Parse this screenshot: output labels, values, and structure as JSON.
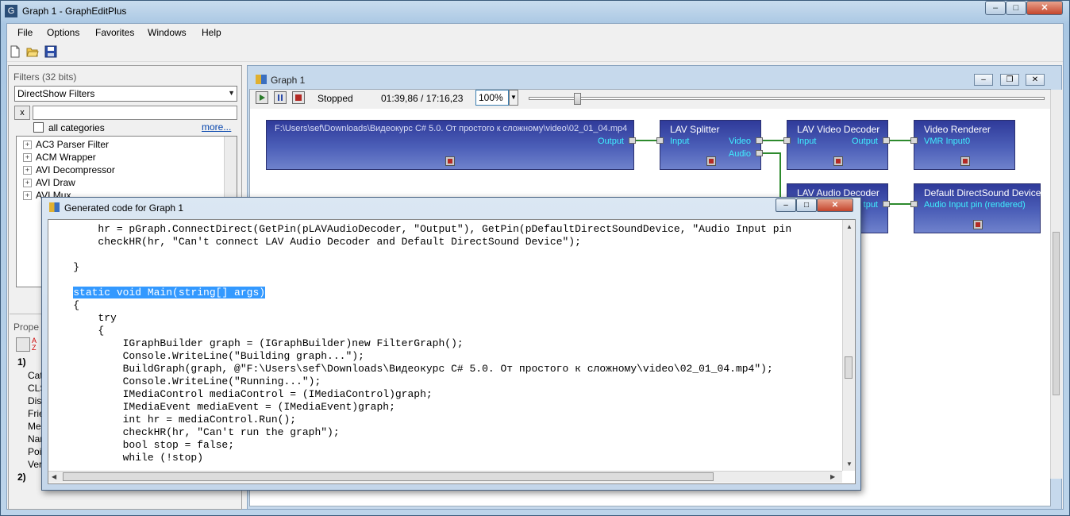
{
  "window": {
    "title": "Graph 1 - GraphEditPlus"
  },
  "menu": [
    "File",
    "Options",
    "Favorites",
    "Windows",
    "Help"
  ],
  "filters_panel": {
    "label": "Filters (32 bits)",
    "combo_value": "DirectShow Filters",
    "clear_button": "x",
    "all_categories": "all categories",
    "more_link": "more...",
    "items": [
      "AC3 Parser Filter",
      "ACM Wrapper",
      "AVI Decompressor",
      "AVI Draw",
      "AVI Mux"
    ]
  },
  "properties_panel": {
    "label": "Prope",
    "rows": [
      "1)",
      "Cat",
      "CLS",
      "Disp",
      "Frie",
      "Mer",
      "Nar",
      "Poi",
      "Ver",
      "2)"
    ]
  },
  "graph_window": {
    "title": "Graph 1",
    "state": "Stopped",
    "time": "01:39,86 / 17:16,23",
    "zoom": "100%",
    "seek_fraction": 0.096
  },
  "graph": {
    "source": {
      "name": "F:\\Users\\sef\\Downloads\\Видеокурс C# 5.0. От простого к сложному\\video\\02_01_04.mp4",
      "out": "Output"
    },
    "splitter": {
      "name": "LAV Splitter",
      "in": "Input",
      "out_video": "Video",
      "out_audio": "Audio"
    },
    "vdec": {
      "name": "LAV Video Decoder",
      "in": "Input",
      "out": "Output"
    },
    "vrend": {
      "name": "Video Renderer",
      "in": "VMR Input0"
    },
    "adec": {
      "name": "LAV Audio Decoder",
      "out": "tput"
    },
    "arend": {
      "name": "Default DirectSound Device",
      "in": "Audio Input pin (rendered)"
    }
  },
  "code_window": {
    "title": "Generated code for Graph 1",
    "lines": [
      "        hr = pGraph.ConnectDirect(GetPin(pLAVAudioDecoder, \"Output\"), GetPin(pDefaultDirectSoundDevice, \"Audio Input pin",
      "        checkHR(hr, \"Can't connect LAV Audio Decoder and Default DirectSound Device\");",
      "",
      "    }",
      "",
      "    static void Main(string[] args)",
      "    {",
      "        try",
      "        {",
      "            IGraphBuilder graph = (IGraphBuilder)new FilterGraph();",
      "            Console.WriteLine(\"Building graph...\");",
      "            BuildGraph(graph, @\"F:\\Users\\sef\\Downloads\\Видеокурс C# 5.0. От простого к сложному\\video\\02_01_04.mp4\");",
      "            Console.WriteLine(\"Running...\");",
      "            IMediaControl mediaControl = (IMediaControl)graph;",
      "            IMediaEvent mediaEvent = (IMediaEvent)graph;",
      "            int hr = mediaControl.Run();",
      "            checkHR(hr, \"Can't run the graph\");",
      "            bool stop = false;",
      "            while (!stop)"
    ],
    "highlight_line": 5,
    "highlight_text": "static void Main(string[] args)"
  }
}
